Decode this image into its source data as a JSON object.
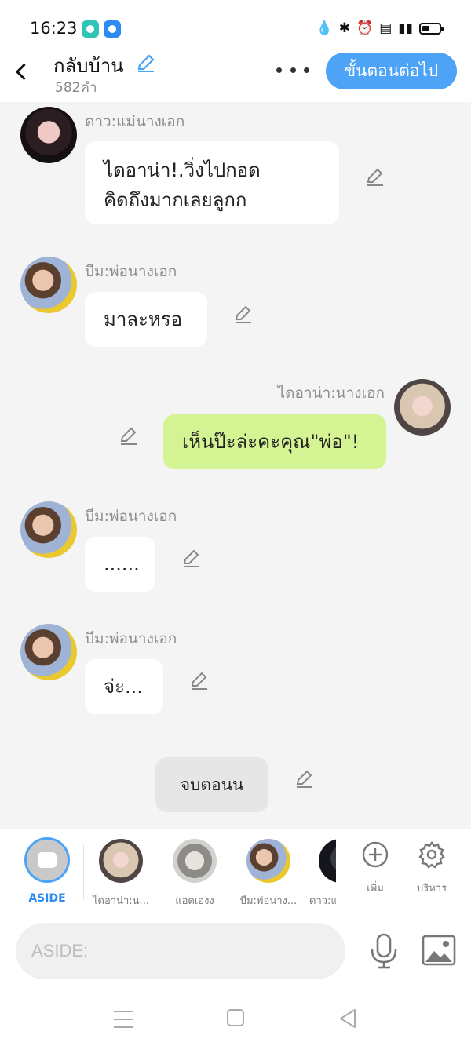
{
  "status": {
    "time": "16:23"
  },
  "header": {
    "title": "กลับบ้าน",
    "subtitle": "582คำ",
    "next_label": "ขั้นตอนต่อไป"
  },
  "messages": [
    {
      "sender": "ดาว:แม่นางเอก",
      "lines": [
        "ไดอาน่า!.วิ่งไปกอด",
        "คิดถึงมากเลยลูกก"
      ],
      "side": "left",
      "avatar": "dao"
    },
    {
      "sender": "บีม:พ่อนางเอก",
      "lines": [
        "มาละหรอ"
      ],
      "side": "left",
      "avatar": "beam"
    },
    {
      "sender": "ไดอาน่า:นางเอก",
      "lines": [
        "เห็นป๊ะล่ะคะคุณ\"พ่อ\"!"
      ],
      "side": "right",
      "avatar": "diana"
    },
    {
      "sender": "บีม:พ่อนางเอก",
      "lines": [
        "......"
      ],
      "side": "left",
      "avatar": "beam"
    },
    {
      "sender": "บีม:พ่อนางเอก",
      "lines": [
        "จ่ะ..."
      ],
      "side": "left",
      "avatar": "beam"
    }
  ],
  "end_chapter_label": "จบตอนน",
  "character_bar": {
    "aside_label": "ASIDE",
    "characters": [
      {
        "label": "ไดอาน่า:น...",
        "avatar": "diana"
      },
      {
        "label": "แอดเองง",
        "avatar": "cat"
      },
      {
        "label": "บีม:พ่อนาง...",
        "avatar": "beam"
      },
      {
        "label": "ดาว:แ",
        "avatar": "dark"
      }
    ],
    "add_label": "เพิ่ม",
    "manage_label": "บริหาร"
  },
  "input": {
    "placeholder": "ASIDE:"
  },
  "icons": {
    "edit": "pencil-icon",
    "more": "more-dots-icon",
    "back": "chevron-left-icon",
    "add": "plus-circle-icon",
    "manage": "gear-icon",
    "mic": "microphone-icon",
    "image": "image-icon"
  },
  "colors": {
    "accent": "#4da3f5",
    "my_bubble": "#d4f393",
    "other_bubble": "#ffffff",
    "background": "#f4f4f4"
  }
}
